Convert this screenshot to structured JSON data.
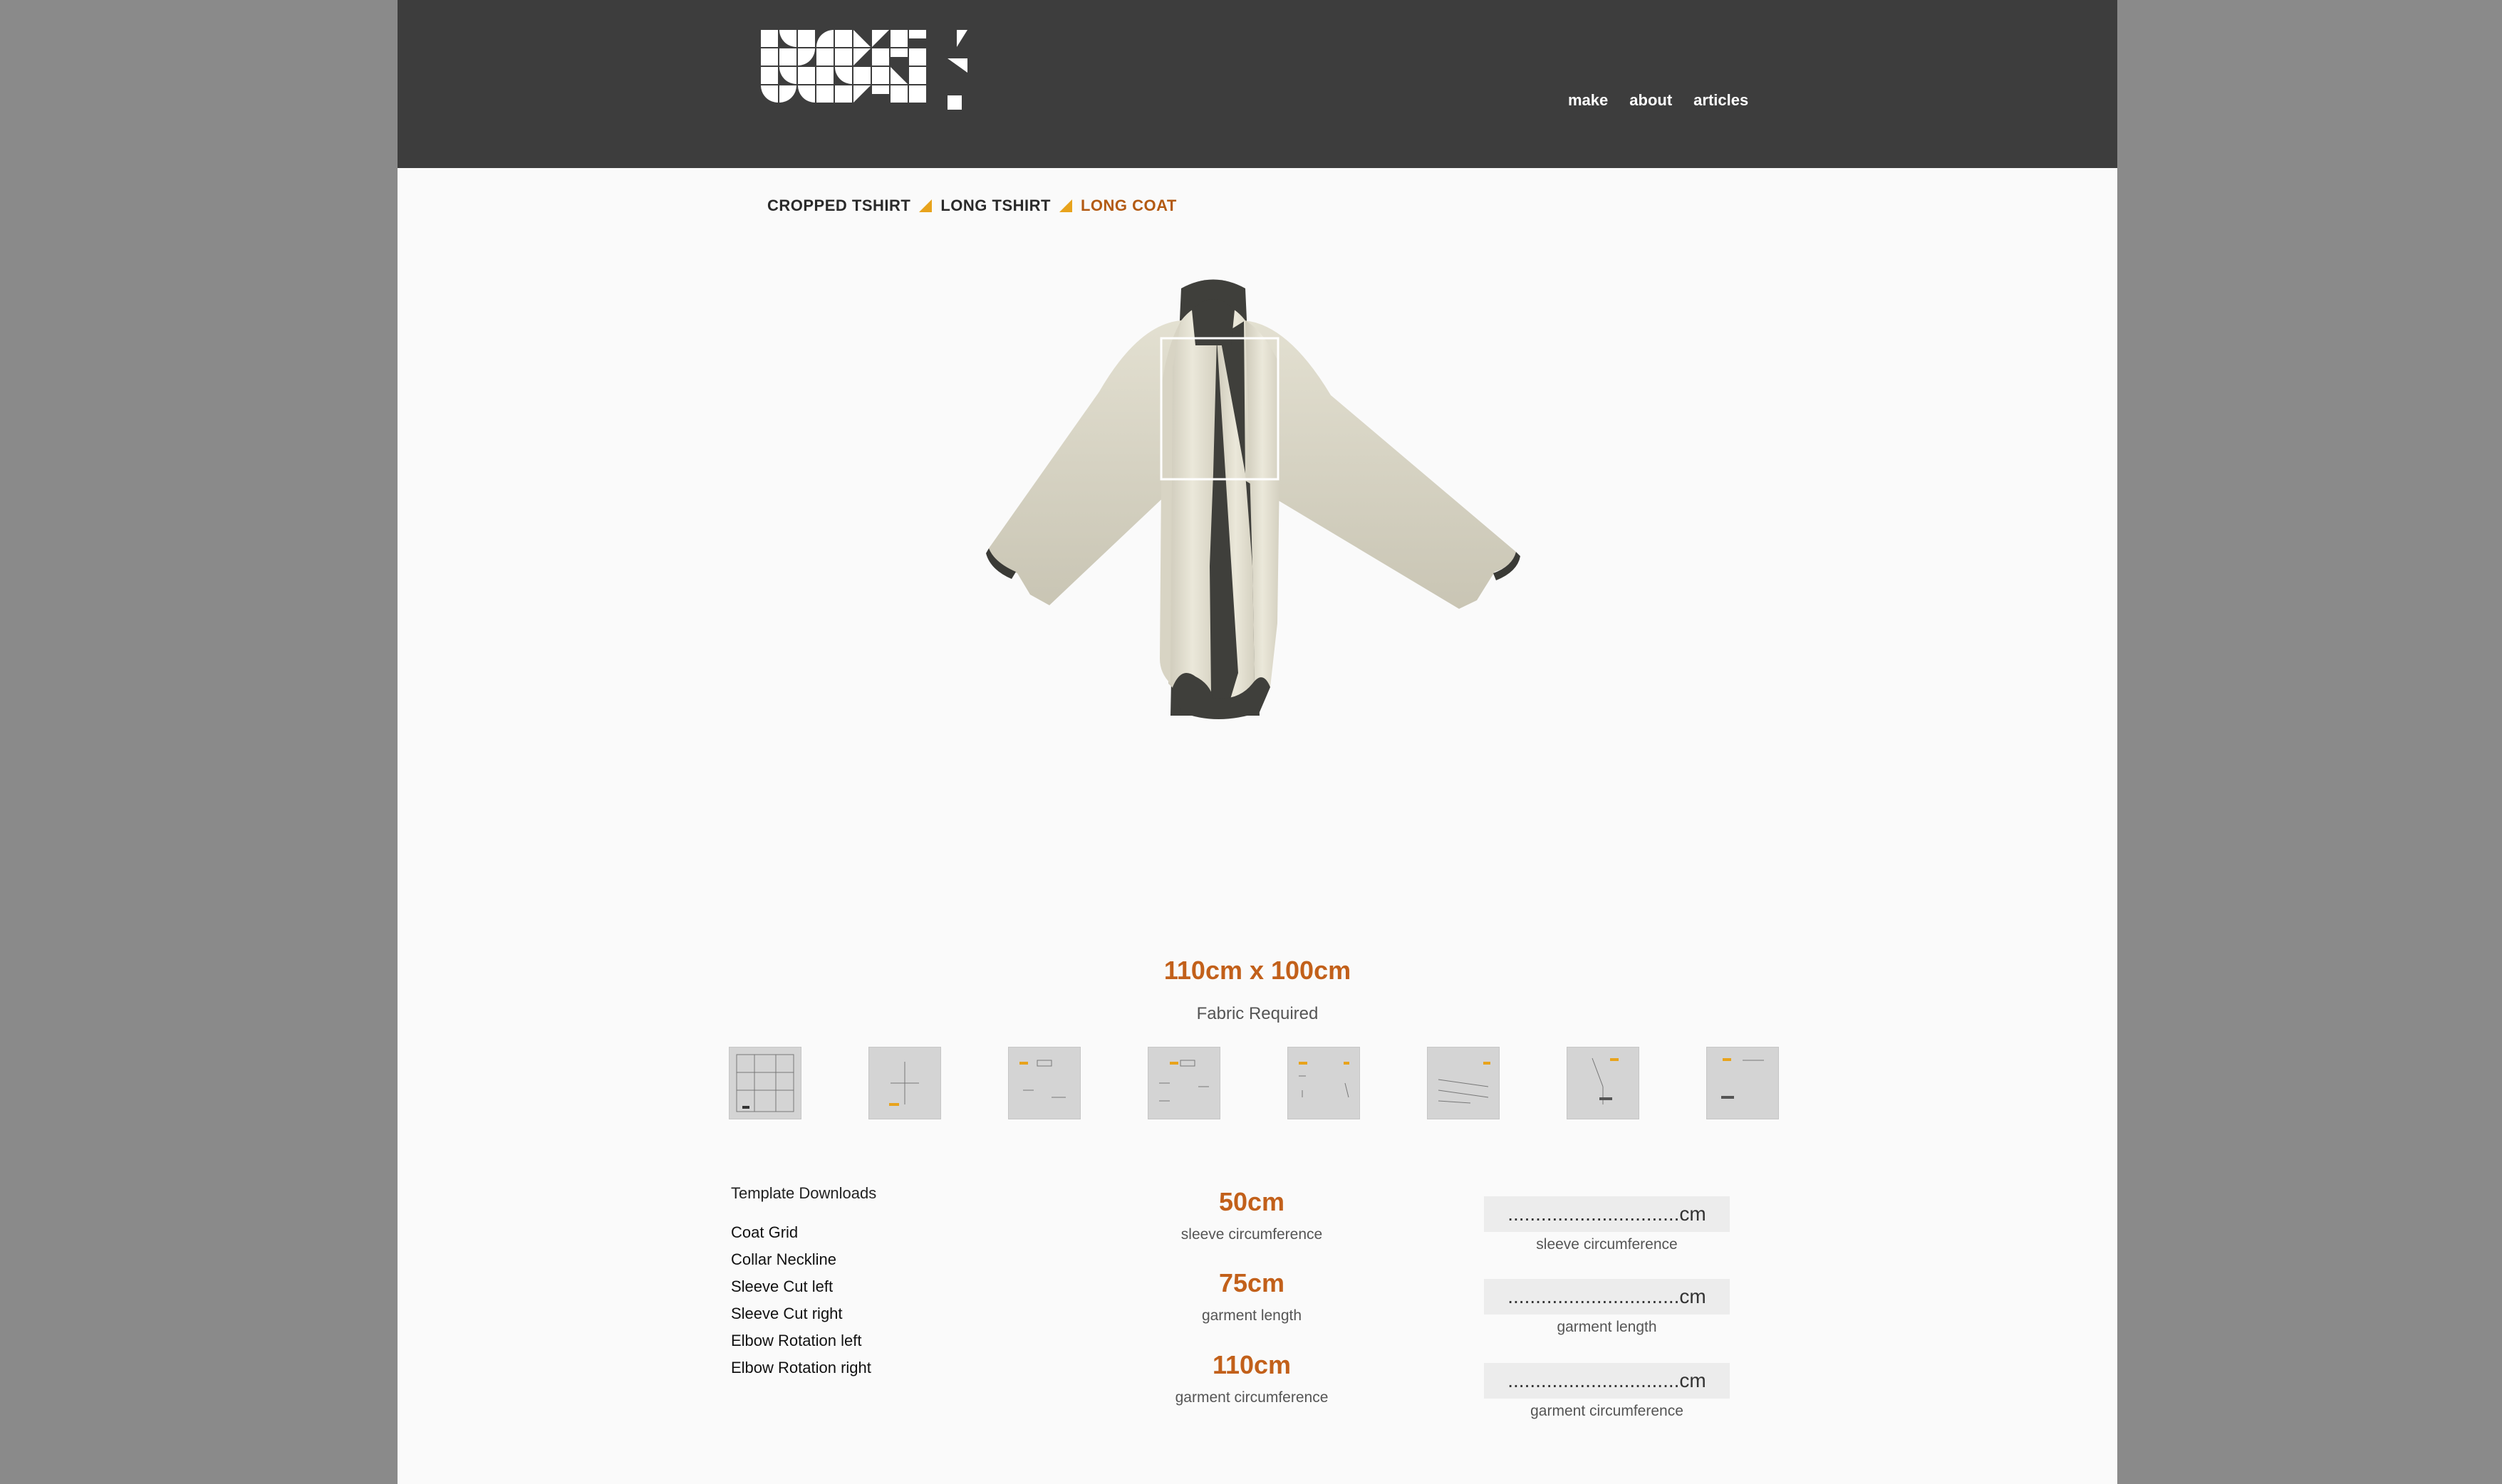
{
  "nav": {
    "items": [
      "make",
      "about",
      "articles"
    ]
  },
  "breadcrumb": {
    "items": [
      "CROPPED TSHIRT",
      "LONG TSHIRT",
      "LONG COAT"
    ],
    "active_index": 2
  },
  "colors": {
    "accent": "#c2601a",
    "header_bg": "#3d3d3d",
    "page_bg": "#fafafa",
    "outer_bg": "#8a8a8a",
    "separator": "#e8a31c"
  },
  "fabric": {
    "size": "110cm x 100cm",
    "label": "Fabric Required"
  },
  "thumbnails": {
    "count": 8
  },
  "downloads": {
    "title": "Template Downloads",
    "links": [
      "Coat Grid",
      "Collar Neckline",
      "Sleeve Cut left",
      "Sleeve Cut right",
      "Elbow Rotation left",
      "Elbow Rotation right"
    ]
  },
  "measurements": [
    {
      "value": "50cm",
      "label": "sleeve circumference"
    },
    {
      "value": "75cm",
      "label": "garment length"
    },
    {
      "value": "110cm",
      "label": "garment circumference"
    }
  ],
  "inputs": [
    {
      "value": "...............................cm",
      "label": "sleeve circumference"
    },
    {
      "value": "...............................cm",
      "label": "garment length"
    },
    {
      "value": "...............................cm",
      "label": "garment circumference"
    }
  ]
}
